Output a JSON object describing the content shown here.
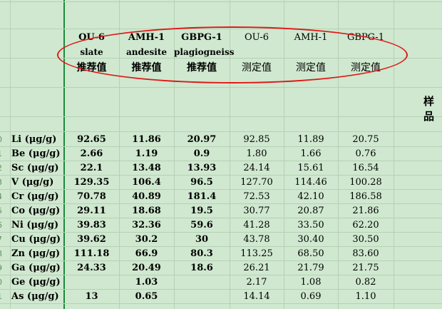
{
  "header": {
    "columns": [
      {
        "name": "OU-6",
        "sub": "slate",
        "label": "推荐值",
        "bold": true
      },
      {
        "name": "AMH-1",
        "sub": "andesite",
        "label": "推荐值",
        "bold": true
      },
      {
        "name": "GBPG-1",
        "sub": "plagiogneiss",
        "label": "推荐值",
        "bold": true
      },
      {
        "name": "OU-6",
        "sub": "",
        "label": "测定值",
        "bold": false
      },
      {
        "name": "AMH-1",
        "sub": "",
        "label": "测定值",
        "bold": false
      },
      {
        "name": "GBPG-1",
        "sub": "",
        "label": "测定值",
        "bold": false
      }
    ],
    "side_label": "样品"
  },
  "rows": [
    {
      "num": "0",
      "element": "Li (μg/g)",
      "v": [
        "92.65",
        "11.86",
        "20.97",
        "92.85",
        "11.89",
        "20.75"
      ]
    },
    {
      "num": "1",
      "element": "Be (μg/g)",
      "v": [
        "2.66",
        "1.19",
        "0.9",
        "1.80",
        "1.66",
        "0.76"
      ]
    },
    {
      "num": "2",
      "element": "Sc (μg/g)",
      "v": [
        "22.1",
        "13.48",
        "13.93",
        "24.14",
        "15.61",
        "16.54"
      ]
    },
    {
      "num": "3",
      "element": "V (μg/g)",
      "v": [
        "129.35",
        "106.4",
        "96.5",
        "127.70",
        "114.46",
        "100.28"
      ]
    },
    {
      "num": "4",
      "element": "Cr (μg/g)",
      "v": [
        "70.78",
        "40.89",
        "181.4",
        "72.53",
        "42.10",
        "186.58"
      ]
    },
    {
      "num": "5",
      "element": "Co (μg/g)",
      "v": [
        "29.11",
        "18.68",
        "19.5",
        "30.77",
        "20.87",
        "21.86"
      ]
    },
    {
      "num": "6",
      "element": "Ni (μg/g)",
      "v": [
        "39.83",
        "32.36",
        "59.6",
        "41.28",
        "33.50",
        "62.20"
      ]
    },
    {
      "num": "7",
      "element": "Cu (μg/g)",
      "v": [
        "39.62",
        "30.2",
        "30",
        "43.78",
        "30.40",
        "30.50"
      ]
    },
    {
      "num": "8",
      "element": "Zn (μg/g)",
      "v": [
        "111.18",
        "66.9",
        "80.3",
        "113.25",
        "68.50",
        "83.60"
      ]
    },
    {
      "num": "9",
      "element": "Ga (μg/g)",
      "v": [
        "24.33",
        "20.49",
        "18.6",
        "26.21",
        "21.79",
        "21.75"
      ]
    },
    {
      "num": "0",
      "element": "Ge (μg/g)",
      "v": [
        "",
        "1.03",
        "",
        "2.17",
        "1.08",
        "0.82"
      ]
    },
    {
      "num": "1",
      "element": "As (μg/g)",
      "v": [
        "13",
        "0.65",
        "",
        "14.14",
        "0.69",
        "1.10"
      ]
    }
  ]
}
